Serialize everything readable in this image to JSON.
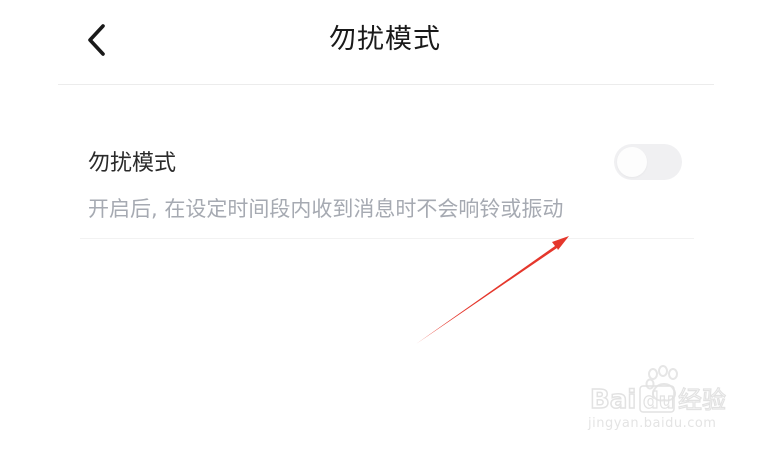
{
  "header": {
    "title": "勿扰模式",
    "back_icon": "chevron-left-icon"
  },
  "settings": {
    "dnd": {
      "title": "勿扰模式",
      "description": "开启后, 在设定时间段内收到消息时不会响铃或振动",
      "enabled": false
    }
  },
  "annotation": {
    "arrow_color": "#e5372c"
  },
  "watermark": {
    "brand": "Baidu经验",
    "url": "jingyan.baidu.com"
  },
  "colors": {
    "title_text": "#1a1a1a",
    "desc_text": "#a6aab2",
    "toggle_off": "#f0f0f2"
  }
}
